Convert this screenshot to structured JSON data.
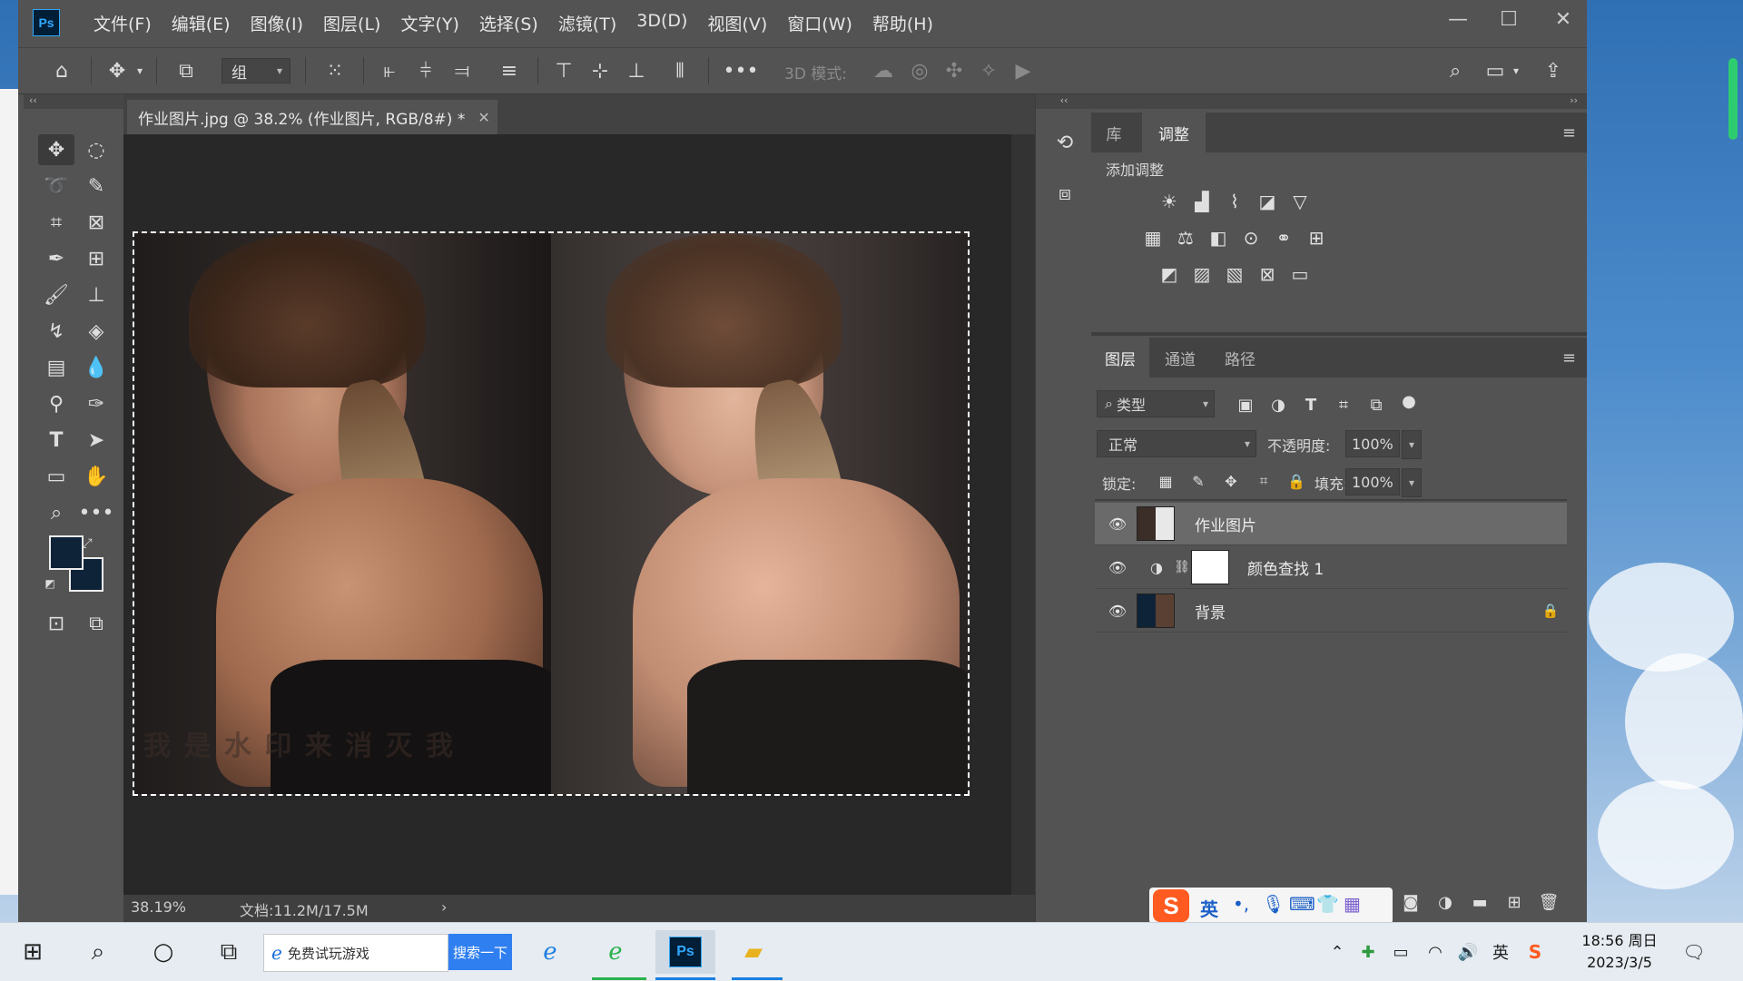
{
  "app": {
    "logo": "Ps",
    "menu": [
      "文件(F)",
      "编辑(E)",
      "图像(I)",
      "图层(L)",
      "文字(Y)",
      "选择(S)",
      "滤镜(T)",
      "3D(D)",
      "视图(V)",
      "窗口(W)",
      "帮助(H)"
    ]
  },
  "options_bar": {
    "auto_select_value": "组",
    "mode_3d_label": "3D 模式:"
  },
  "document": {
    "tab_title": "作业图片.jpg @ 38.2% (作业图片, RGB/8#) *",
    "zoom": "38.19%",
    "doc_info": "文档:11.2M/17.5M",
    "watermark": "我 是 水 印 来 消 灭 我"
  },
  "colors": {
    "foreground": "#0e2338",
    "background": "#0e2338",
    "accent": "#31a8ff"
  },
  "adjust_panel": {
    "tabs": [
      "库",
      "调整"
    ],
    "active_tab": "调整",
    "heading": "添加调整"
  },
  "layers_panel": {
    "tabs": [
      "图层",
      "通道",
      "路径"
    ],
    "active_tab": "图层",
    "filter_label": "类型",
    "blend_mode": "正常",
    "opacity_label": "不透明度:",
    "opacity_value": "100%",
    "lock_label": "锁定:",
    "fill_label": "填充:",
    "fill_value": "100%",
    "layers": [
      {
        "name": "作业图片",
        "selected": true
      },
      {
        "name": "颜色查找 1",
        "selected": false
      },
      {
        "name": "背景",
        "selected": false,
        "locked": true
      }
    ]
  },
  "ime": {
    "lang": "英"
  },
  "taskbar": {
    "search_text": "免费试玩游戏",
    "search_button": "搜索一下",
    "time": "18:56 周日",
    "date": "2023/3/5",
    "tray_lang": "英"
  }
}
